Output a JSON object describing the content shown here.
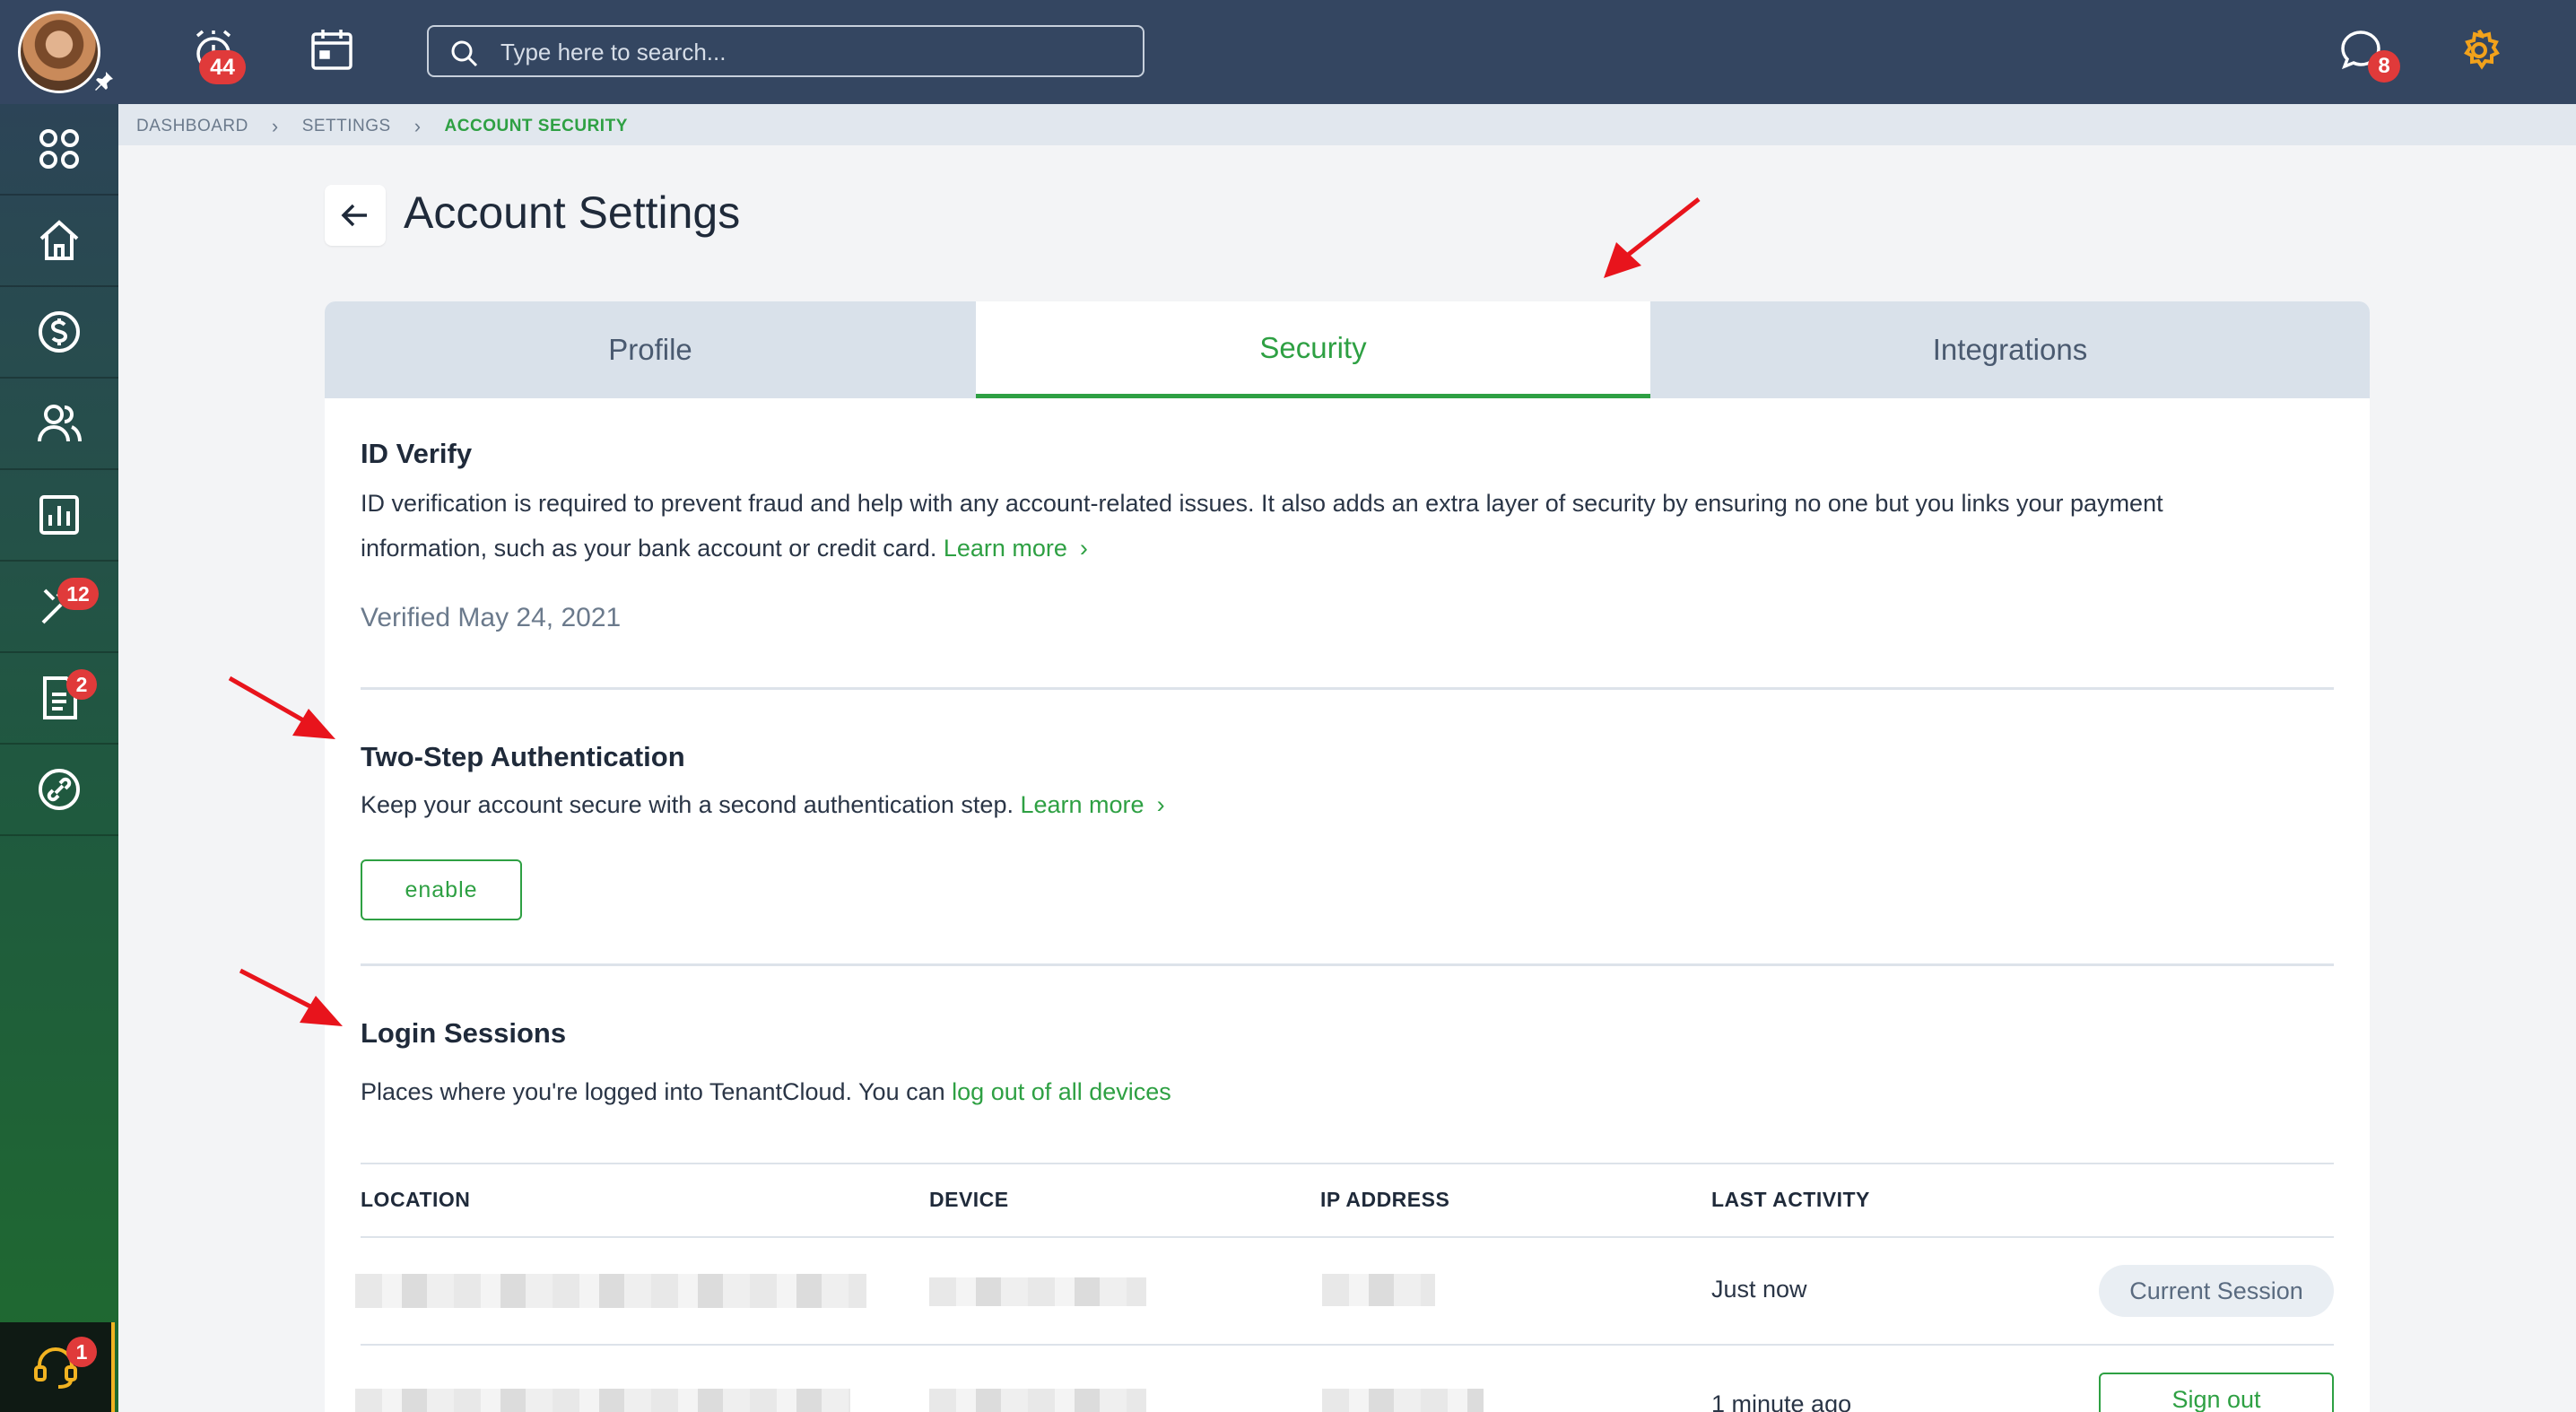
{
  "topbar": {
    "alarm_badge": "44",
    "search_placeholder": "Type here to search...",
    "messages_badge": "8"
  },
  "sidebar": {
    "items": [
      {
        "icon": "apps-icon"
      },
      {
        "icon": "home-icon"
      },
      {
        "icon": "dollar-icon"
      },
      {
        "icon": "users-icon"
      },
      {
        "icon": "reports-icon"
      },
      {
        "icon": "tools-icon",
        "badge": "12"
      },
      {
        "icon": "document-icon",
        "badge": "2"
      },
      {
        "icon": "link-icon"
      }
    ],
    "support_badge": "1"
  },
  "breadcrumb": [
    "DASHBOARD",
    "SETTINGS",
    "ACCOUNT SECURITY"
  ],
  "page": {
    "title": "Account Settings"
  },
  "tabs": [
    "Profile",
    "Security",
    "Integrations"
  ],
  "id_verify": {
    "title": "ID Verify",
    "text_line1": "ID verification is required to prevent fraud and help with any account-related issues. It also adds an extra layer of security by ensuring no one but you links your payment",
    "text_line2": "information, such as your bank account or credit card.",
    "learn_more": "Learn more",
    "verified": "Verified May 24, 2021"
  },
  "two_step": {
    "title": "Two-Step Authentication",
    "text": "Keep your account secure with a second authentication step.",
    "learn_more": "Learn more",
    "button": "enable"
  },
  "login_sessions": {
    "title": "Login Sessions",
    "text": "Places where you're logged into TenantCloud. You can",
    "link": "log out of all devices",
    "columns": [
      "LOCATION",
      "DEVICE",
      "IP ADDRESS",
      "LAST ACTIVITY"
    ],
    "rows": [
      {
        "last_activity": "Just now",
        "action": "Current Session"
      },
      {
        "last_activity": "1 minute ago",
        "action": "Sign out"
      }
    ]
  },
  "colors": {
    "accent": "#2ea043",
    "topbar": "#344661",
    "badge": "#e03a3a",
    "annotation": "#e8141c"
  }
}
